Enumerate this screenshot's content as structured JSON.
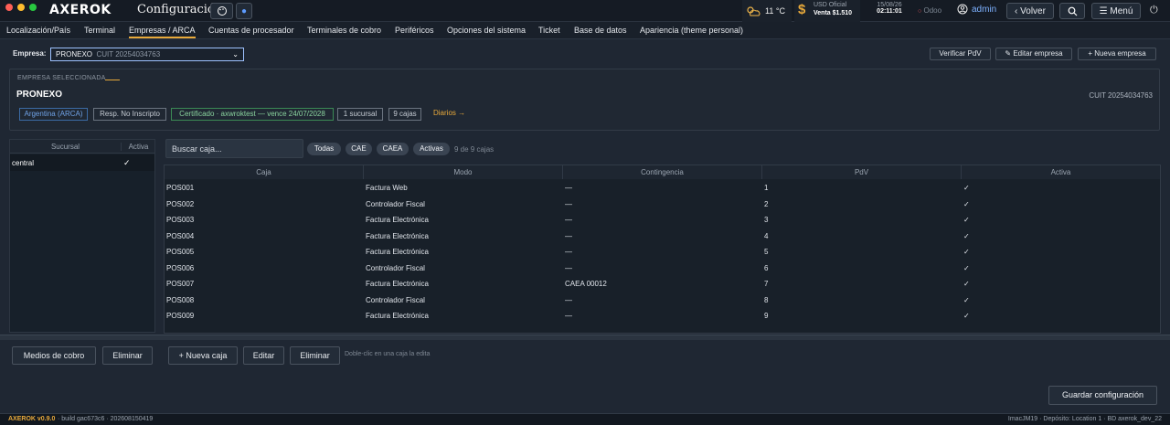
{
  "window": {
    "logo": "AXEROK",
    "title": "Configuración",
    "button_icon": "palette-icon",
    "button_dot": "●"
  },
  "header": {
    "weather": "11 °C",
    "usd_label": "USD Oficial",
    "usd_value": "Venta $1.510",
    "date": "15/08/26",
    "time": "02:11:01",
    "odoo": "Odoo",
    "user": "admin",
    "back": "Volver",
    "menu": "Menú",
    "accent_color": "#e8a93a"
  },
  "tabs": [
    "Localización/País",
    "Terminal",
    "Empresas / ARCA",
    "Cuentas de procesador",
    "Terminales de cobro",
    "Periféricos",
    "Opciones del sistema",
    "Ticket",
    "Base de datos",
    "Apariencia (theme personal)"
  ],
  "empresa": {
    "label": "Empresa:",
    "selected": "PRONEXO",
    "cuit": "CUIT 20254034763",
    "verify": "Verificar PdV",
    "edit": "✎ Editar empresa",
    "new": "+ Nueva empresa"
  },
  "selected_company": {
    "caption": "EMPRESA SELECCIONADA",
    "name": "PRONEXO",
    "cuit": "CUIT 20254034763",
    "chips": [
      "Argentina (ARCA)",
      "Resp. No Inscripto",
      "Certificado · axwroktest — vence 24/07/2028",
      "1 sucursal",
      "9 cajas"
    ],
    "diarios": "Diarios →"
  },
  "sucursales": {
    "headers": [
      "Sucursal",
      "Activa"
    ],
    "rows": [
      {
        "name": "central",
        "active": "✓"
      }
    ]
  },
  "cajas": {
    "search_placeholder": "Buscar caja...",
    "filters": [
      "Todas",
      "CAE",
      "CAEA",
      "Activas"
    ],
    "count": "9 de 9 cajas",
    "headers": [
      "Caja",
      "Modo",
      "Contingencia",
      "PdV",
      "Activa"
    ],
    "rows": [
      [
        "POS001",
        "Factura Web",
        "—",
        "1",
        "✓"
      ],
      [
        "POS002",
        "Controlador Fiscal",
        "—",
        "2",
        "✓"
      ],
      [
        "POS003",
        "Factura Electrónica",
        "—",
        "3",
        "✓"
      ],
      [
        "POS004",
        "Factura Electrónica",
        "—",
        "4",
        "✓"
      ],
      [
        "POS005",
        "Factura Electrónica",
        "—",
        "5",
        "✓"
      ],
      [
        "POS006",
        "Controlador Fiscal",
        "—",
        "6",
        "✓"
      ],
      [
        "POS007",
        "Factura Electrónica",
        "CAEA 00012",
        "7",
        "✓"
      ],
      [
        "POS008",
        "Controlador Fiscal",
        "—",
        "8",
        "✓"
      ],
      [
        "POS009",
        "Factura Electrónica",
        "—",
        "9",
        "✓"
      ]
    ]
  },
  "buttons": {
    "medios": "Medios de cobro",
    "eliminar_suc": "Eliminar",
    "nueva_caja": "+ Nueva caja",
    "editar": "Editar",
    "eliminar_caja": "Eliminar",
    "hint": "Doble-clic en una caja la edita",
    "guardar": "Guardar configuración"
  },
  "footer": {
    "version": "AXEROK v0.9.0",
    "build": "· build gac673c6 · 202608150419",
    "right": "ImacJM19 · Depósito: Location 1 · BD axerok_dev_22"
  }
}
